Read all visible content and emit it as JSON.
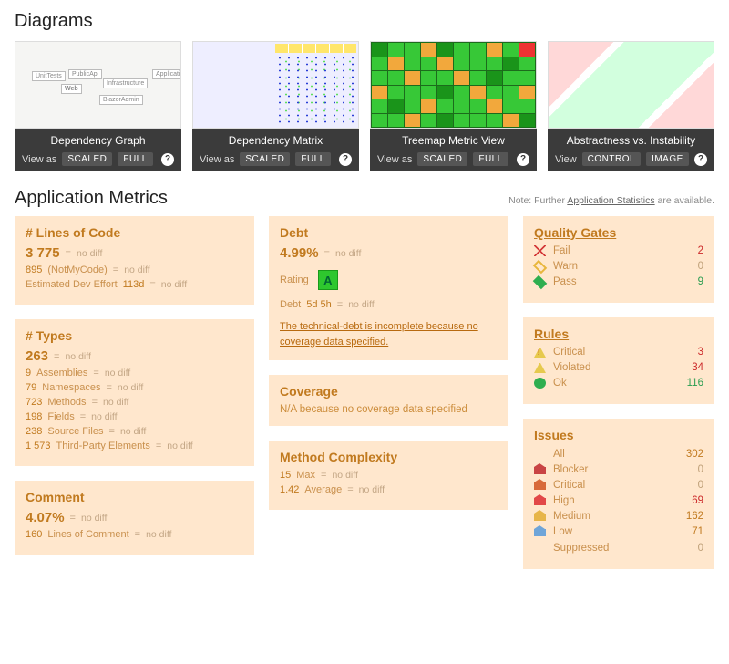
{
  "sections": {
    "diagrams_title": "Diagrams",
    "metrics_title": "Application Metrics",
    "metrics_note_prefix": "Note: Further ",
    "metrics_note_link": "Application Statistics",
    "metrics_note_suffix": " are available."
  },
  "diagrams": [
    {
      "title": "Dependency Graph",
      "view_label": "View as",
      "actions": [
        "SCALED",
        "FULL"
      ]
    },
    {
      "title": "Dependency Matrix",
      "view_label": "View as",
      "actions": [
        "SCALED",
        "FULL"
      ]
    },
    {
      "title": "Treemap Metric View",
      "view_label": "View as",
      "actions": [
        "SCALED",
        "FULL"
      ]
    },
    {
      "title": "Abstractness vs. Instability",
      "view_label": "View",
      "actions": [
        "CONTROL",
        "IMAGE"
      ]
    }
  ],
  "loc": {
    "title": "# Lines of Code",
    "value": "3 775",
    "nodiff": "no diff",
    "rows": [
      {
        "val": "895",
        "label": "(NotMyCode)",
        "nodiff": "no diff"
      },
      {
        "val": "Estimated Dev Effort",
        "label": "113d",
        "nodiff": "no diff"
      }
    ]
  },
  "types": {
    "title": "# Types",
    "value": "263",
    "nodiff": "no diff",
    "rows": [
      {
        "val": "9",
        "label": "Assemblies",
        "nodiff": "no diff"
      },
      {
        "val": "79",
        "label": "Namespaces",
        "nodiff": "no diff"
      },
      {
        "val": "723",
        "label": "Methods",
        "nodiff": "no diff"
      },
      {
        "val": "198",
        "label": "Fields",
        "nodiff": "no diff"
      },
      {
        "val": "238",
        "label": "Source Files",
        "nodiff": "no diff"
      },
      {
        "val": "1 573",
        "label": "Third-Party Elements",
        "nodiff": "no diff"
      }
    ]
  },
  "comment": {
    "title": "Comment",
    "value": "4.07%",
    "nodiff": "no diff",
    "rows": [
      {
        "val": "160",
        "label": "Lines of Comment",
        "nodiff": "no diff"
      }
    ]
  },
  "debt": {
    "title": "Debt",
    "value": "4.99%",
    "nodiff": "no diff",
    "rating_label": "Rating",
    "rating": "A",
    "debt_label": "Debt",
    "debt_value": "5d 5h",
    "debt_nodiff": "no diff",
    "note": "The technical-debt is incomplete because no coverage data specified."
  },
  "coverage": {
    "title": "Coverage",
    "text": "N/A because no coverage data specified"
  },
  "complexity": {
    "title": "Method Complexity",
    "rows": [
      {
        "val": "15",
        "label": "Max",
        "nodiff": "no diff"
      },
      {
        "val": "1.42",
        "label": "Average",
        "nodiff": "no diff"
      }
    ]
  },
  "quality_gates": {
    "title": "Quality Gates",
    "rows": [
      {
        "icon": "fail",
        "label": "Fail",
        "count": "2",
        "cls": "red"
      },
      {
        "icon": "warn",
        "label": "Warn",
        "count": "0",
        "cls": "zero"
      },
      {
        "icon": "pass",
        "label": "Pass",
        "count": "9",
        "cls": "green"
      }
    ]
  },
  "rules": {
    "title": "Rules",
    "rows": [
      {
        "icon": "crit",
        "label": "Critical",
        "count": "3",
        "cls": "red"
      },
      {
        "icon": "viol",
        "label": "Violated",
        "count": "34",
        "cls": "red"
      },
      {
        "icon": "ok",
        "label": "Ok",
        "count": "116",
        "cls": "green"
      }
    ]
  },
  "issues": {
    "title": "Issues",
    "rows": [
      {
        "icon": "",
        "label": "All",
        "count": "302",
        "cls": "orange"
      },
      {
        "icon": "blocker",
        "label": "Blocker",
        "count": "0",
        "cls": "zero"
      },
      {
        "icon": "critical",
        "label": "Critical",
        "count": "0",
        "cls": "zero"
      },
      {
        "icon": "high",
        "label": "High",
        "count": "69",
        "cls": "red"
      },
      {
        "icon": "medium",
        "label": "Medium",
        "count": "162",
        "cls": "orange"
      },
      {
        "icon": "low",
        "label": "Low",
        "count": "71",
        "cls": "orange"
      },
      {
        "icon": "",
        "label": "Suppressed",
        "count": "0",
        "cls": "zero"
      }
    ]
  }
}
